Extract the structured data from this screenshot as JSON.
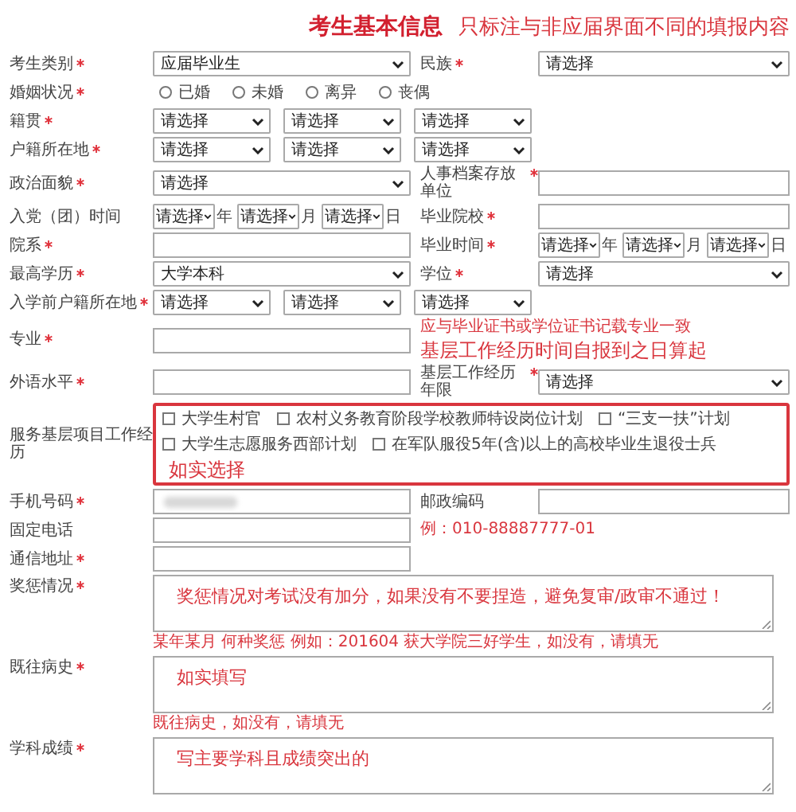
{
  "header": {
    "title": "考生基本信息",
    "note": "只标注与非应届界面不同的填报内容"
  },
  "rows": [
    {
      "kind": "fields",
      "cells": [
        {
          "label": "考生类别",
          "required": true,
          "field": {
            "kind": "select",
            "value": "应届毕业生"
          }
        },
        {
          "label": "民族",
          "required": true,
          "field": {
            "kind": "select",
            "value": "请选择"
          }
        }
      ]
    },
    {
      "kind": "fields",
      "cells": [
        {
          "label": "婚姻状况",
          "required": true,
          "field": {
            "kind": "radios",
            "options": [
              {
                "label": "已婚",
                "selected": false
              },
              {
                "label": "未婚",
                "selected": false
              },
              {
                "label": "离异",
                "selected": false
              },
              {
                "label": "丧偶",
                "selected": false
              }
            ]
          }
        }
      ]
    },
    {
      "kind": "fields",
      "cells": [
        {
          "label": "籍贯",
          "required": true,
          "field": {
            "kind": "selects",
            "values": [
              "请选择",
              "请选择",
              "请选择"
            ]
          }
        }
      ]
    },
    {
      "kind": "fields",
      "cells": [
        {
          "label": "户籍所在地",
          "required": true,
          "field": {
            "kind": "selects",
            "values": [
              "请选择",
              "请选择",
              "请选择"
            ]
          }
        }
      ]
    },
    {
      "kind": "fields",
      "cells": [
        {
          "label": "政治面貌",
          "required": true,
          "field": {
            "kind": "select",
            "value": "请选择"
          }
        },
        {
          "label": "人事档案存放单位",
          "required": true,
          "field": {
            "kind": "input"
          }
        }
      ]
    },
    {
      "kind": "fields",
      "cells": [
        {
          "label": "入党（团）时间",
          "required": false,
          "field": {
            "kind": "date",
            "parts": [
              {
                "value": "请选择",
                "unit": "年"
              },
              {
                "value": "请选择",
                "unit": "月"
              },
              {
                "value": "请选择",
                "unit": "日"
              }
            ]
          }
        },
        {
          "label": "毕业院校",
          "required": true,
          "field": {
            "kind": "input"
          }
        }
      ]
    },
    {
      "kind": "fields",
      "cells": [
        {
          "label": "院系",
          "required": true,
          "field": {
            "kind": "input"
          }
        },
        {
          "label": "毕业时间",
          "required": true,
          "field": {
            "kind": "date",
            "parts": [
              {
                "value": "请选择",
                "unit": "年"
              },
              {
                "value": "请选择",
                "unit": "月"
              },
              {
                "value": "请选择",
                "unit": "日"
              }
            ]
          }
        }
      ]
    },
    {
      "kind": "fields",
      "cells": [
        {
          "label": "最高学历",
          "required": true,
          "field": {
            "kind": "select",
            "value": "大学本科"
          }
        },
        {
          "label": "学位",
          "required": true,
          "field": {
            "kind": "select",
            "value": "请选择"
          }
        }
      ]
    },
    {
      "kind": "fields",
      "cells": [
        {
          "label": "入学前户籍所在地",
          "required": true,
          "field": {
            "kind": "selects",
            "values": [
              "请选择",
              "请选择",
              "请选择"
            ]
          }
        }
      ]
    },
    {
      "kind": "fields",
      "cells": [
        {
          "label": "专业",
          "required": true,
          "field": {
            "kind": "input"
          }
        },
        {
          "notes": [
            {
              "kind": "hint",
              "text": "应与毕业证书或学位证书记载专业一致"
            },
            {
              "kind": "annotation",
              "text": "基层工作经历时间自报到之日算起"
            }
          ]
        }
      ]
    },
    {
      "kind": "fields",
      "cells": [
        {
          "label": "外语水平",
          "required": true,
          "field": {
            "kind": "input"
          }
        },
        {
          "label": "基层工作经历年限",
          "required": true,
          "field": {
            "kind": "select",
            "value": "请选择"
          }
        }
      ]
    },
    {
      "kind": "fields",
      "cells": [
        {
          "label": "服务基层项目工作经历",
          "required": false,
          "field": {
            "kind": "checks",
            "annotation": "如实选择",
            "options": [
              {
                "label": "大学生村官",
                "checked": false
              },
              {
                "label": "农村义务教育阶段学校教师特设岗位计划",
                "checked": false
              },
              {
                "label": "“三支一扶”计划",
                "checked": false
              },
              {
                "label": "大学生志愿服务西部计划",
                "checked": false
              },
              {
                "label": "在军队服役5年(含)以上的高校毕业生退役士兵",
                "checked": false
              }
            ]
          }
        }
      ]
    },
    {
      "kind": "fields",
      "cells": [
        {
          "label": "手机号码",
          "required": true,
          "field": {
            "kind": "redacted"
          }
        },
        {
          "label": "邮政编码",
          "required": false,
          "field": {
            "kind": "input"
          }
        }
      ]
    },
    {
      "kind": "fields",
      "cells": [
        {
          "label": "固定电话",
          "required": false,
          "field": {
            "kind": "input"
          }
        },
        {
          "notes": [
            {
              "kind": "hint",
              "text": "例：010-88887777-01"
            }
          ]
        }
      ]
    },
    {
      "kind": "fields",
      "cells": [
        {
          "label": "通信地址",
          "required": true,
          "field": {
            "kind": "input"
          }
        }
      ]
    },
    {
      "kind": "textarea",
      "label": "奖惩情况",
      "required": true,
      "annotation": "奖惩情况对考试没有加分，如果没有不要捏造，避免复审/政审不通过！",
      "hint": "某年某月 何种奖惩 例如：201604 获大学院三好学生，如没有，请填无"
    },
    {
      "kind": "textarea",
      "label": "既往病史",
      "required": true,
      "annotation": "如实填写",
      "hint": "既往病史，如没有，请填无"
    },
    {
      "kind": "textarea",
      "label": "学科成绩",
      "required": true,
      "annotation": "写主要学科且成绩突出的"
    }
  ]
}
